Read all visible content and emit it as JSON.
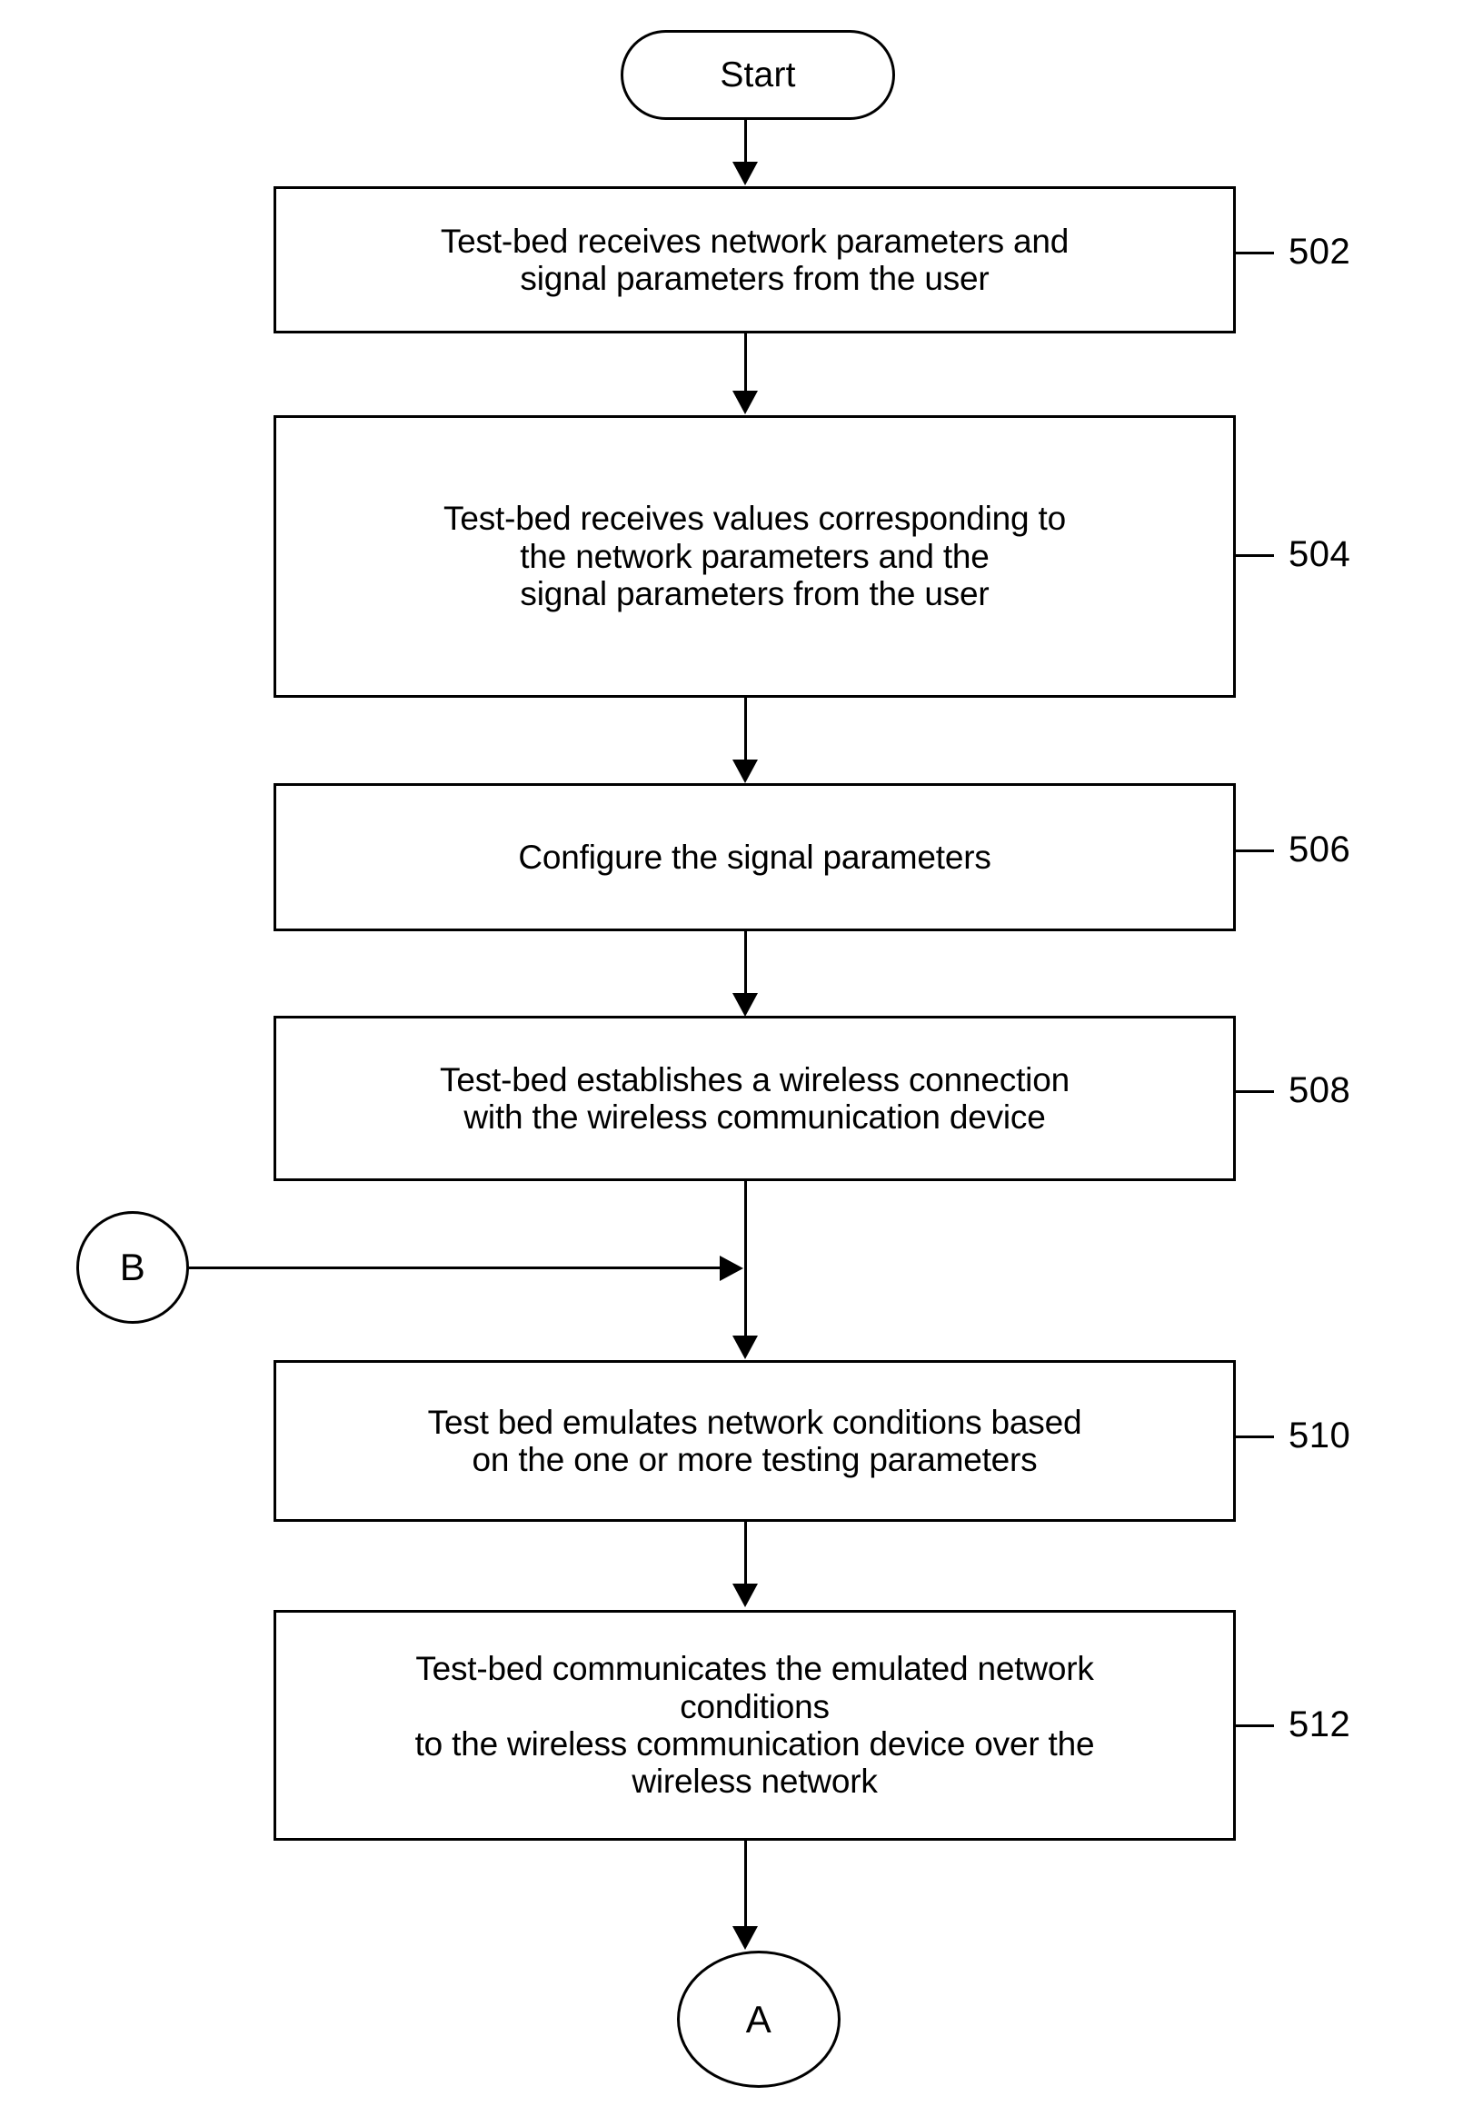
{
  "diagram": {
    "type": "flowchart",
    "orientation": "vertical",
    "stroke_color": "#000000",
    "background_color": "#ffffff",
    "nodes": [
      {
        "id": "start",
        "shape": "terminator",
        "label": "Start",
        "ref": null
      },
      {
        "id": "step502",
        "shape": "process",
        "label": "Test-bed receives network parameters and\nsignal parameters from the user",
        "ref": "502"
      },
      {
        "id": "step504",
        "shape": "process",
        "label": "Test-bed receives values corresponding to\nthe network parameters and the\nsignal parameters from the user",
        "ref": "504"
      },
      {
        "id": "step506",
        "shape": "process",
        "label": "Configure the signal parameters",
        "ref": "506"
      },
      {
        "id": "step508",
        "shape": "process",
        "label": "Test-bed establishes a wireless connection\nwith the wireless communication device",
        "ref": "508"
      },
      {
        "id": "connectorB",
        "shape": "connector",
        "label": "B",
        "ref": null
      },
      {
        "id": "step510",
        "shape": "process",
        "label": "Test bed emulates network conditions based\non the one or more testing parameters",
        "ref": "510"
      },
      {
        "id": "step512",
        "shape": "process",
        "label": "Test-bed communicates the emulated network\nconditions\nto the wireless communication device over the\nwireless network",
        "ref": "512"
      },
      {
        "id": "connectorA",
        "shape": "connector",
        "label": "A",
        "ref": null
      }
    ],
    "edges": [
      {
        "from": "start",
        "to": "step502",
        "direction": "down"
      },
      {
        "from": "step502",
        "to": "step504",
        "direction": "down"
      },
      {
        "from": "step504",
        "to": "step506",
        "direction": "down"
      },
      {
        "from": "step506",
        "to": "step508",
        "direction": "down"
      },
      {
        "from": "step508",
        "to": "step510",
        "direction": "down"
      },
      {
        "from": "connectorB",
        "to": "step510",
        "direction": "right"
      },
      {
        "from": "step510",
        "to": "step512",
        "direction": "down"
      },
      {
        "from": "step512",
        "to": "connectorA",
        "direction": "down"
      }
    ]
  }
}
